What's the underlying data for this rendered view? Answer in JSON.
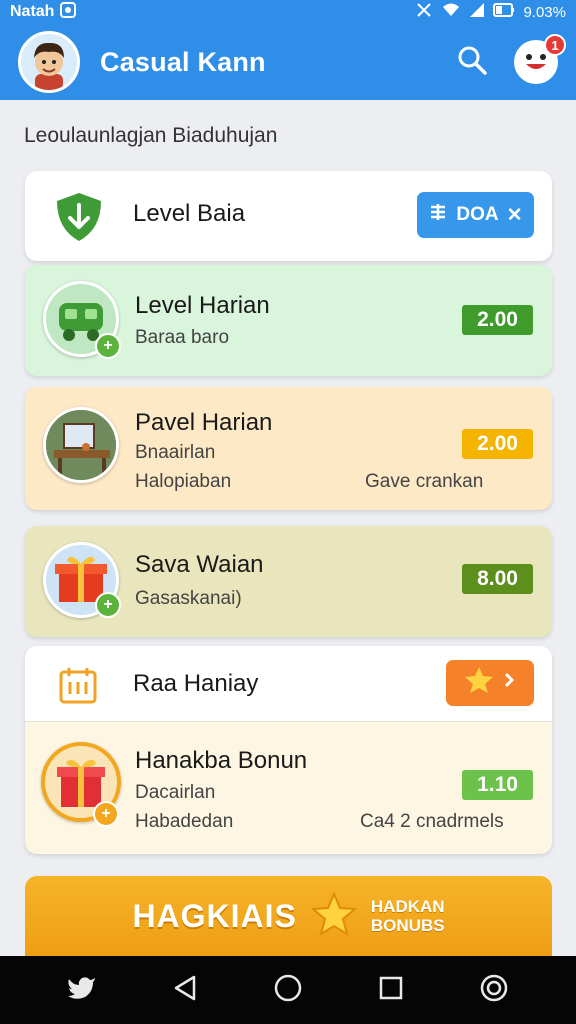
{
  "status": {
    "carrier": "Natah",
    "battery_text": "9.03%"
  },
  "appbar": {
    "title": "Casual Kann",
    "notification_count": "1"
  },
  "section_heading": "Leoulaunlagjan Biaduhujan",
  "cards": [
    {
      "title": "Level Baia",
      "action_label": "DOA",
      "action_symbol": "✕"
    },
    {
      "title": "Level Harian",
      "subtitle": "Baraa baro",
      "value": "2.00",
      "value_color": "#3e9b2c"
    },
    {
      "title": "Pavel Harian",
      "subtitle": "Bnaairlan",
      "subtitle2": "Halopiaban",
      "note": "Gave crankan",
      "value": "2.00",
      "value_color": "#f4b400"
    },
    {
      "title": "Sava Waian",
      "subtitle": "Gasaskanai)",
      "value": "8.00",
      "value_color": "#5d8f1c"
    },
    {
      "title": "Raa Haniay"
    },
    {
      "title": "Hanakba Bonun",
      "subtitle": "Dacairlan",
      "subtitle2": "Habadedan",
      "note": "Ca4 2 cnadrmels",
      "value": "1.10",
      "value_color": "#6cc24a"
    }
  ],
  "banner": {
    "main": "HAGKIAIS",
    "side_line1": "HADKAN",
    "side_line2": "BONUBS"
  },
  "colors": {
    "primary": "#2f8fe8",
    "green_card": "#d9f5dc",
    "orange_card": "#fde9c6",
    "olive_card": "#e9e6bd",
    "cream_card": "#fdf6e3",
    "orange_button": "#f5822a",
    "blue_button": "#3797ea"
  }
}
